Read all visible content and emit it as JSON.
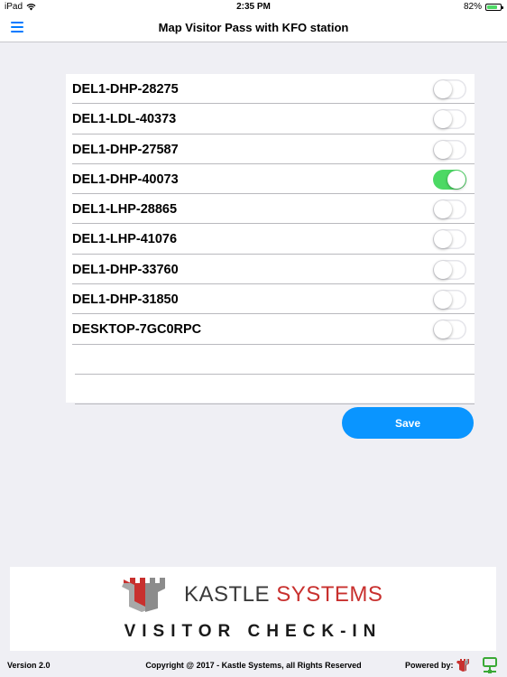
{
  "status_bar": {
    "device": "iPad",
    "time": "2:35 PM",
    "battery": "82%",
    "battery_level": 0.82
  },
  "navbar": {
    "title": "Map Visitor Pass with KFO station"
  },
  "stations": [
    {
      "name": "DEL1-DHP-28275",
      "enabled": false
    },
    {
      "name": "DEL1-LDL-40373",
      "enabled": false
    },
    {
      "name": "DEL1-DHP-27587",
      "enabled": false
    },
    {
      "name": "DEL1-DHP-40073",
      "enabled": true
    },
    {
      "name": "DEL1-LHP-28865",
      "enabled": false
    },
    {
      "name": "DEL1-LHP-41076",
      "enabled": false
    },
    {
      "name": "DEL1-DHP-33760",
      "enabled": false
    },
    {
      "name": "DEL1-DHP-31850",
      "enabled": false
    },
    {
      "name": "DESKTOP-7GC0RPC",
      "enabled": false
    }
  ],
  "save_label": "Save",
  "banner": {
    "brand_kastle": "KASTLE",
    "brand_systems": " SYSTEMS",
    "tagline": "VISITOR CHECK-IN"
  },
  "footer": {
    "version": "Version 2.0",
    "copyright": "Copyright @ 2017 - Kastle Systems, all Rights Reserved",
    "powered_by": "Powered by:"
  },
  "colors": {
    "accent": "#007aff",
    "save_button": "#0a95ff",
    "toggle_on": "#4cd964",
    "brand_red": "#c8302e"
  },
  "icons": [
    "ipad-wifi-icon",
    "menu-icon",
    "battery-icon",
    "kastle-castle-logo",
    "network-icon"
  ]
}
